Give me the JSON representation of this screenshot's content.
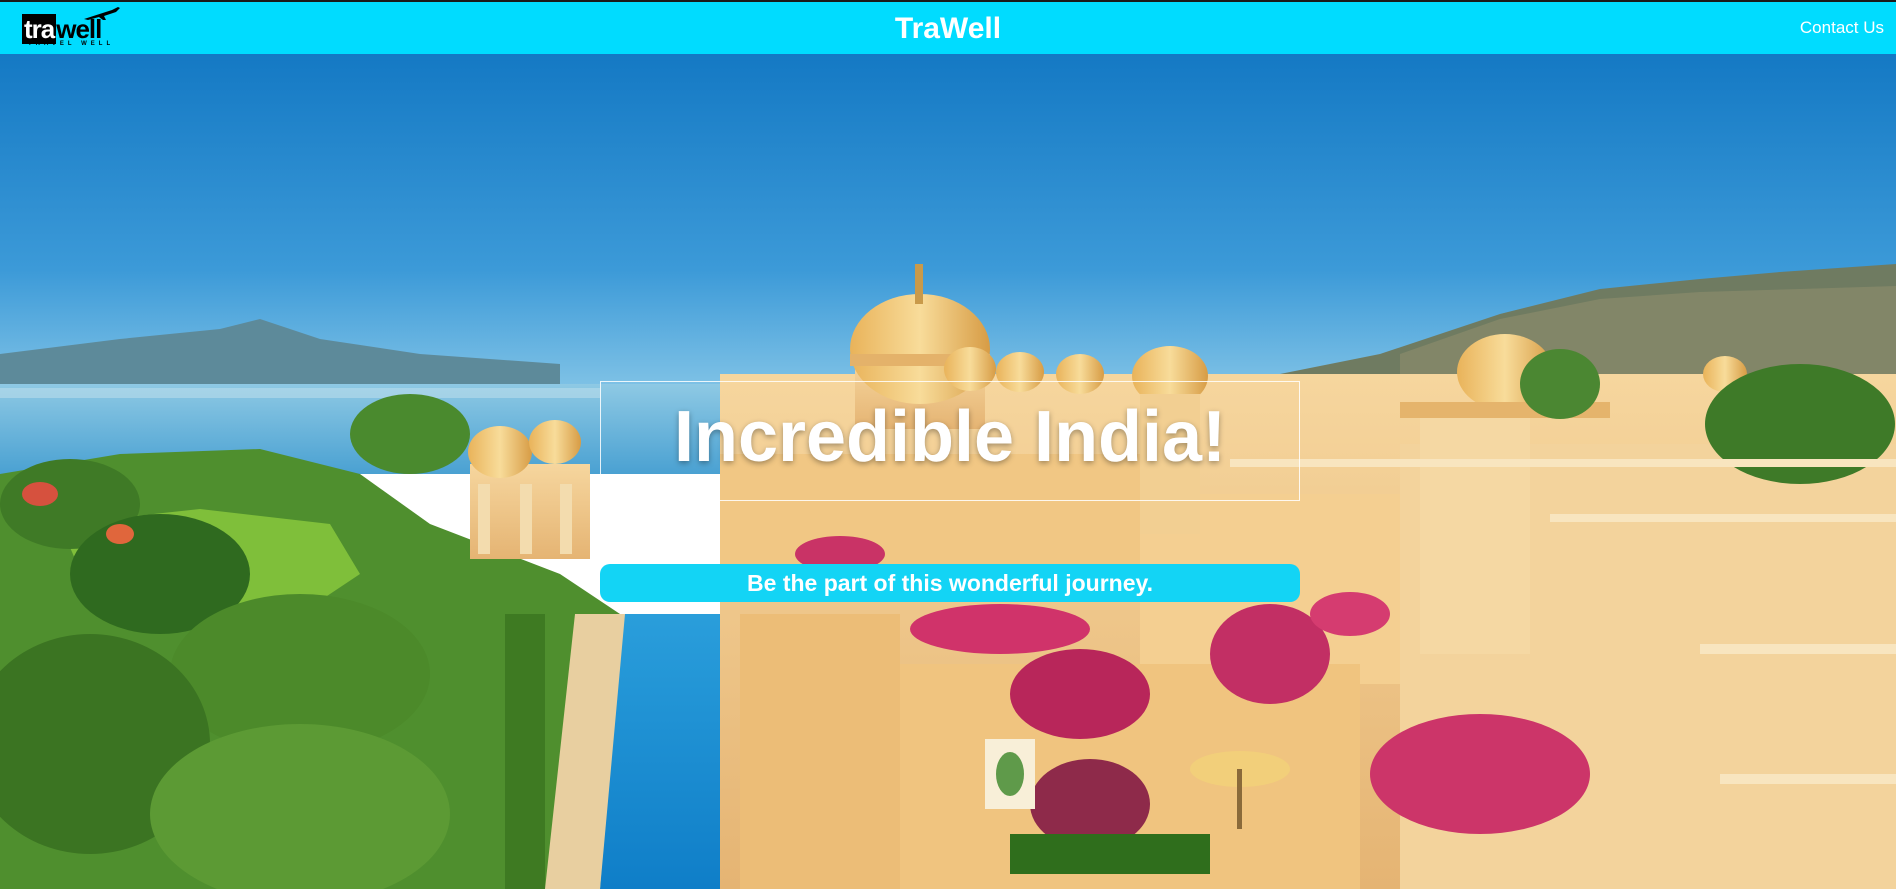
{
  "navbar": {
    "logo_main_left": "tra",
    "logo_main_right": "well",
    "logo_tagline": "TRAVEL WELL",
    "brand_title": "TraWell",
    "contact_label": "Contact Us"
  },
  "hero": {
    "headline": "Incredible India!",
    "subline": "Be the part of this wonderful journey."
  },
  "colors": {
    "navbar_bg": "#00dcff",
    "subline_bg": "#13d4f5",
    "text_light": "#ffffff"
  }
}
